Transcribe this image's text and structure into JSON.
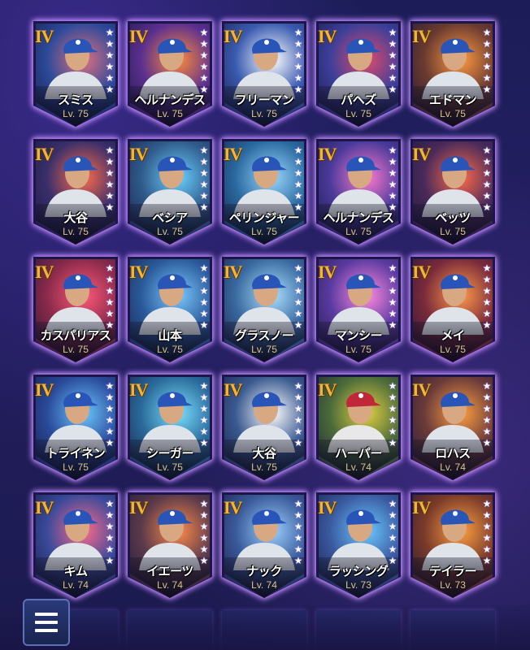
{
  "cards": [
    {
      "name": "スミス",
      "level": "Lv. 75",
      "grade": "IV",
      "bg": "#2c4a9a",
      "accent": "#e07080",
      "cap": "#2a55b8"
    },
    {
      "name": "ヘルナンデス",
      "level": "Lv. 75",
      "grade": "IV",
      "bg": "#5a2f8f",
      "accent": "#ff8a3a",
      "cap": "#2a55b8"
    },
    {
      "name": "フリーマン",
      "level": "Lv. 75",
      "grade": "IV",
      "bg": "#3a5bb0",
      "accent": "#ffffff",
      "cap": "#2a55b8"
    },
    {
      "name": "パヘズ",
      "level": "Lv. 75",
      "grade": "IV",
      "bg": "#3c3f9a",
      "accent": "#e04a6a",
      "cap": "#2a55b8"
    },
    {
      "name": "エドマン",
      "level": "Lv. 75",
      "grade": "IV",
      "bg": "#6a3a30",
      "accent": "#ff9a40",
      "cap": "#2a55b8"
    },
    {
      "name": "大谷",
      "level": "Lv. 75",
      "grade": "IV",
      "bg": "#3a2f6a",
      "accent": "#ff6a4a",
      "cap": "#2a55b8"
    },
    {
      "name": "ベシア",
      "level": "Lv. 75",
      "grade": "IV",
      "bg": "#2f5a8a",
      "accent": "#6ad0ff",
      "cap": "#2a55b8"
    },
    {
      "name": "ペリンジャー",
      "level": "Lv. 75",
      "grade": "IV",
      "bg": "#2a6aa0",
      "accent": "#9ad8ff",
      "cap": "#2a55b8"
    },
    {
      "name": "ヘルナンデス",
      "level": "Lv. 75",
      "grade": "IV",
      "bg": "#4a3a9a",
      "accent": "#ff7ad0",
      "cap": "#2a55b8"
    },
    {
      "name": "ベッツ",
      "level": "Lv. 75",
      "grade": "IV",
      "bg": "#4a2a5a",
      "accent": "#ff6a4a",
      "cap": "#2a55b8"
    },
    {
      "name": "カスパリアス",
      "level": "Lv. 75",
      "grade": "IV",
      "bg": "#8a2a4a",
      "accent": "#ff5a7a",
      "cap": "#2a55b8"
    },
    {
      "name": "山本",
      "level": "Lv. 75",
      "grade": "IV",
      "bg": "#2a5a9a",
      "accent": "#7ac8ff",
      "cap": "#2a55b8"
    },
    {
      "name": "グラスノー",
      "level": "Lv. 75",
      "grade": "IV",
      "bg": "#3a6aa0",
      "accent": "#aae0ff",
      "cap": "#2a55b8"
    },
    {
      "name": "マンシー",
      "level": "Lv. 75",
      "grade": "IV",
      "bg": "#5a3aa0",
      "accent": "#ff8ae0",
      "cap": "#2a55b8"
    },
    {
      "name": "メイ",
      "level": "Lv. 75",
      "grade": "IV",
      "bg": "#7a2a3a",
      "accent": "#ff9a4a",
      "cap": "#2a55b8"
    },
    {
      "name": "トライネン",
      "level": "Lv. 75",
      "grade": "IV",
      "bg": "#2a4a9a",
      "accent": "#6ac8ff",
      "cap": "#2a55b8"
    },
    {
      "name": "シーガー",
      "level": "Lv. 75",
      "grade": "IV",
      "bg": "#2a6a9a",
      "accent": "#7ae0ff",
      "cap": "#2a55b8"
    },
    {
      "name": "大谷",
      "level": "Lv. 75",
      "grade": "IV",
      "bg": "#3a5a90",
      "accent": "#ffffff",
      "cap": "#2a55b8"
    },
    {
      "name": "ハーパー",
      "level": "Lv. 74",
      "grade": "IV",
      "bg": "#4a6a3a",
      "accent": "#e0d040",
      "cap": "#c0283a"
    },
    {
      "name": "ロハス",
      "level": "Lv. 74",
      "grade": "IV",
      "bg": "#6a3a3a",
      "accent": "#ffa040",
      "cap": "#2a55b8"
    },
    {
      "name": "キム",
      "level": "Lv. 74",
      "grade": "IV",
      "bg": "#3a4a9a",
      "accent": "#ff6a8a",
      "cap": "#2a55b8"
    },
    {
      "name": "イエーツ",
      "level": "Lv. 74",
      "grade": "IV",
      "bg": "#5a3a4a",
      "accent": "#ff8a4a",
      "cap": "#2a55b8"
    },
    {
      "name": "ナック",
      "level": "Lv. 74",
      "grade": "IV",
      "bg": "#3a5a9a",
      "accent": "#9ad0ff",
      "cap": "#2a55b8"
    },
    {
      "name": "ラッシング",
      "level": "Lv. 73",
      "grade": "IV",
      "bg": "#3a5aa0",
      "accent": "#6ac8ff",
      "cap": "#2a55b8"
    },
    {
      "name": "テイラー",
      "level": "Lv. 73",
      "grade": "IV",
      "bg": "#7a3a2a",
      "accent": "#ffa040",
      "cap": "#2a55b8"
    }
  ],
  "star_count": 6,
  "star_glyph": "★",
  "menu_button": {
    "icon": "hamburger-menu-icon"
  }
}
